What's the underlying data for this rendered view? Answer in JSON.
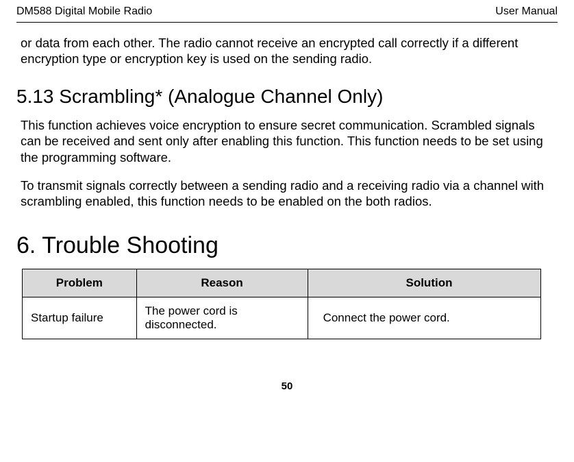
{
  "header": {
    "left": "DM588 Digital Mobile Radio",
    "right": "User Manual"
  },
  "intro_paragraph": "or data from each other. The radio cannot receive an encrypted call correctly if a different encryption type or encryption key is used on the sending radio.",
  "section_513": {
    "heading": "5.13 Scrambling* (Analogue Channel Only)",
    "para1": "This function achieves voice encryption to ensure secret communication. Scrambled signals can be received and sent only after enabling this function. This function needs to be set using the programming software.",
    "para2": "To transmit signals correctly between a sending radio and a receiving radio via a channel with scrambling enabled, this function needs to be enabled on the both radios."
  },
  "section_6": {
    "heading": "6. Trouble Shooting",
    "table": {
      "headers": {
        "problem": "Problem",
        "reason": "Reason",
        "solution": "Solution"
      },
      "rows": [
        {
          "problem": "Startup failure",
          "reason": "The power cord is disconnected.",
          "solution": "Connect the power cord."
        }
      ]
    }
  },
  "footer": {
    "page_number": "50"
  }
}
